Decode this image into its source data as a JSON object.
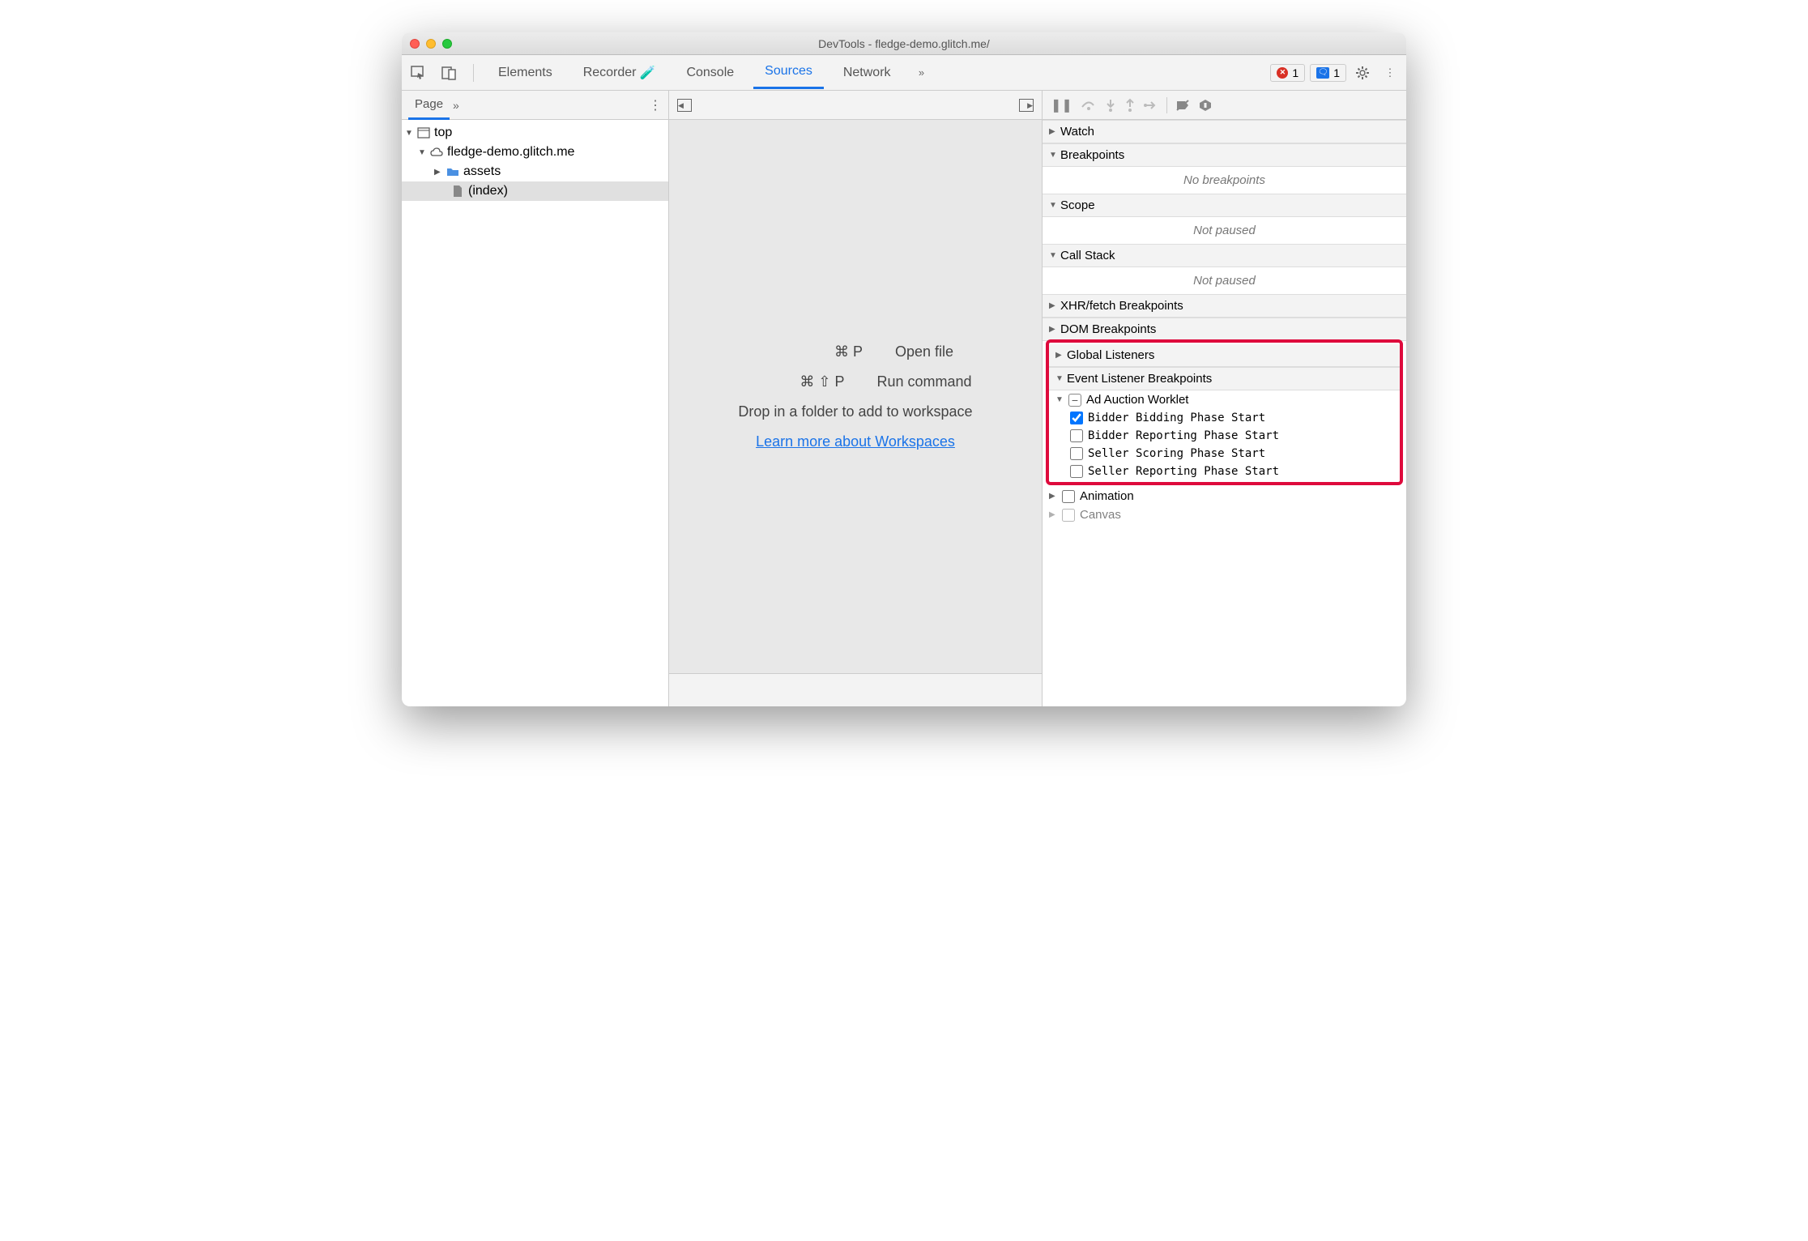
{
  "window": {
    "title": "DevTools - fledge-demo.glitch.me/"
  },
  "toolbar": {
    "tabs": [
      "Elements",
      "Recorder",
      "Console",
      "Sources",
      "Network"
    ],
    "active_tab": "Sources",
    "errors_count": "1",
    "messages_count": "1"
  },
  "leftPanel": {
    "tab": "Page",
    "tree": {
      "top": "top",
      "domain": "fledge-demo.glitch.me",
      "folder": "assets",
      "file": "(index)"
    }
  },
  "midPanel": {
    "openFileKeys": "⌘ P",
    "openFileLabel": "Open file",
    "runCmdKeys": "⌘ ⇧ P",
    "runCmdLabel": "Run command",
    "dropText": "Drop in a folder to add to workspace",
    "link": "Learn more about Workspaces"
  },
  "rightPanel": {
    "sections": {
      "watch": "Watch",
      "breakpoints": "Breakpoints",
      "breakpoints_body": "No breakpoints",
      "scope": "Scope",
      "scope_body": "Not paused",
      "callstack": "Call Stack",
      "callstack_body": "Not paused",
      "xhr": "XHR/fetch Breakpoints",
      "dom": "DOM Breakpoints",
      "global": "Global Listeners",
      "eventListener": "Event Listener Breakpoints",
      "adAuction": "Ad Auction Worklet",
      "events": [
        {
          "label": "Bidder Bidding Phase Start",
          "checked": true
        },
        {
          "label": "Bidder Reporting Phase Start",
          "checked": false
        },
        {
          "label": "Seller Scoring Phase Start",
          "checked": false
        },
        {
          "label": "Seller Reporting Phase Start",
          "checked": false
        }
      ],
      "animation": "Animation",
      "canvas": "Canvas"
    }
  }
}
